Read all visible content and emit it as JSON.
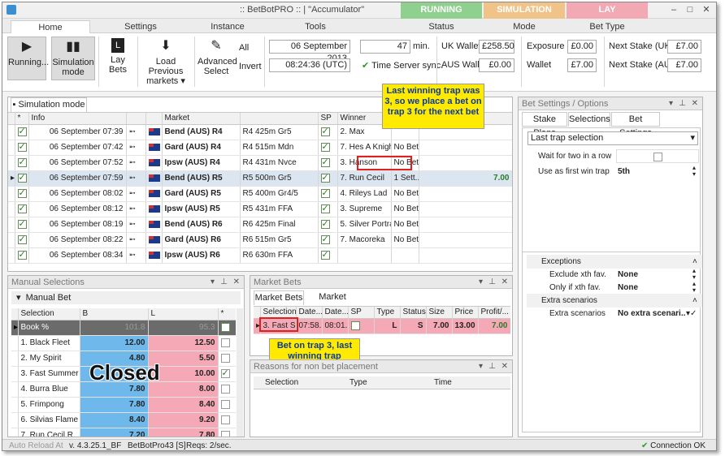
{
  "title": ":: BetBotPRO :: | \"Accumulator\"",
  "states": [
    "RUNNING",
    "SIMULATION",
    "LAY"
  ],
  "ribbon_tabs": [
    "Home",
    "Settings",
    "Instance",
    "Tools",
    "Status",
    "Mode",
    "Bet Type"
  ],
  "ribbon": {
    "running": "Running...",
    "simulation": "Simulation",
    "simulation2": "mode",
    "lay_bets": "Lay Bets",
    "load_prev": "Load Previous",
    "load_prev2": "markets",
    "advanced": "Advanced",
    "advanced2": "Select",
    "all": "All",
    "invert": "Invert",
    "date": "06 September 2013",
    "time": "08:24:36 (UTC)",
    "minutes": "47",
    "min_label": "min.",
    "time_server": "Time Server sync.",
    "uk_wallet_label": "UK Wallet",
    "uk_wallet": "£258.50",
    "aus_wallet_label": "AUS Wallet",
    "aus_wallet": "£0.00",
    "exposure_label": "Exposure",
    "exposure": "£0.00",
    "wallet_label": "Wallet",
    "wallet": "£7.00",
    "next_uk_label": "Next Stake (UK)",
    "next_uk": "£7.00",
    "next_aus_label": "Next Stake (AUS)",
    "next_aus": "£7.00"
  },
  "sim": {
    "tab": "Simulation mode",
    "headers": [
      "*",
      "Info",
      "",
      "",
      "Market",
      "",
      "SP",
      "Winner",
      "",
      ""
    ],
    "rows": [
      {
        "info": "06 September 07:39",
        "market": "Bend (AUS) R4",
        "race": "R4 425m Gr5",
        "winner": "2. Max",
        "bet": "",
        "profit": ""
      },
      {
        "info": "06 September 07:42",
        "market": "Gard (AUS) R4",
        "race": "R4 515m Mdn",
        "winner": "7. Hes A Knight",
        "bet": "No Bet",
        "profit": ""
      },
      {
        "info": "06 September 07:52",
        "market": "Ipsw (AUS) R4",
        "race": "R4 431m Nvce",
        "winner": "3. Hanson",
        "bet": "No Bet",
        "profit": ""
      },
      {
        "info": "06 September 07:59",
        "market": "Bend (AUS) R5",
        "race": "R5 500m Gr5",
        "winner": "7. Run Cecil",
        "bet": "1 Sett...",
        "profit": "7.00"
      },
      {
        "info": "06 September 08:02",
        "market": "Gard (AUS) R5",
        "race": "R5 400m Gr4/5",
        "winner": "4. Rileys Lad",
        "bet": "No Bet",
        "profit": ""
      },
      {
        "info": "06 September 08:12",
        "market": "Ipsw (AUS) R5",
        "race": "R5 431m FFA",
        "winner": "3. Supreme",
        "bet": "No Bet",
        "profit": ""
      },
      {
        "info": "06 September 08:19",
        "market": "Bend (AUS) R6",
        "race": "R6 425m Final",
        "winner": "5. Silver Portrait",
        "bet": "No Bet",
        "profit": ""
      },
      {
        "info": "06 September 08:22",
        "market": "Gard (AUS) R6",
        "race": "R6 515m Gr5",
        "winner": "7. Macoreka",
        "bet": "No Bet",
        "profit": ""
      },
      {
        "info": "06 September 08:34",
        "market": "Ipsw (AUS) R6",
        "race": "R6 630m FFA",
        "winner": "",
        "bet": "",
        "profit": ""
      }
    ]
  },
  "callout1": "Last winning trap was 3, so we place a bet on trap 3 for the next bet",
  "callout2": "Bet on trap 3, last winning trap",
  "manual": {
    "panel": "Manual Selections",
    "section": "Manual Bet",
    "headers": [
      "Selection",
      "B",
      "L",
      "*"
    ],
    "book": "Book %",
    "book_b": "101.8",
    "book_l": "95.3",
    "closed": "Closed",
    "rows": [
      {
        "name": "1. Black Fleet",
        "b": "12.00",
        "l": "12.50"
      },
      {
        "name": "2. My Spirit",
        "b": "4.80",
        "l": "5.50"
      },
      {
        "name": "3. Fast Summer",
        "b": "",
        "l": "10.00"
      },
      {
        "name": "4. Burra Blue",
        "b": "7.80",
        "l": "8.00"
      },
      {
        "name": "5. Frimpong",
        "b": "7.80",
        "l": "8.40"
      },
      {
        "name": "6. Silvias Flame",
        "b": "8.40",
        "l": "9.20"
      },
      {
        "name": "7. Run Cecil R...",
        "b": "7.20",
        "l": "7.80"
      },
      {
        "name": "8. Chuckie Ch...",
        "b": "8.00",
        "l": "9.00"
      }
    ]
  },
  "market_bets": {
    "panel": "Market Bets",
    "tabs": [
      "Market Bets",
      "Market Events"
    ],
    "headers": [
      "Selection",
      "Date...",
      "Date...",
      "SP",
      "Type",
      "Status",
      "Size",
      "Price",
      "Profit/..."
    ],
    "row": {
      "selection": "3. Fast S...",
      "date1": "07:58...",
      "date2": "08:01...",
      "type": "L",
      "status": "S",
      "size": "7.00",
      "price": "13.00",
      "profit": "7.00"
    }
  },
  "reasons": {
    "panel": "Reasons for non bet placement",
    "headers": [
      "Selection",
      "Type",
      "Time"
    ]
  },
  "bet_settings": {
    "panel": "Bet Settings / Options",
    "tabs": [
      "Stake Plans",
      "Selections",
      "Bet Settings"
    ],
    "dropdown": "Last trap selection",
    "wait_label": "Wait for two in a row",
    "first_win_label": "Use as first win trap",
    "first_win_value": "5th",
    "exceptions": "Exceptions",
    "excl_label": "Exclude xth fav.",
    "excl_value": "None",
    "only_label": "Only if xth fav.",
    "only_value": "None",
    "extra": "Extra scenarios",
    "extra_label": "Extra scenarios",
    "extra_value": "No extra scenari..."
  },
  "status": {
    "auto_reload": "Auto Reload At",
    "version": "v. 4.3.25.1_BF",
    "instance": "BetBotPro43 [S]",
    "reqs": "Reqs: 2/sec.",
    "connection": "Connection OK"
  },
  "colors": {
    "running": "#8fd08f",
    "simulation": "#f0c488",
    "lay": "#f3a9b4",
    "back": "#6fb8ec",
    "lay_cell": "#f5a9b6",
    "bet_row": "#f5a9b6",
    "callout": "#ffea00"
  }
}
